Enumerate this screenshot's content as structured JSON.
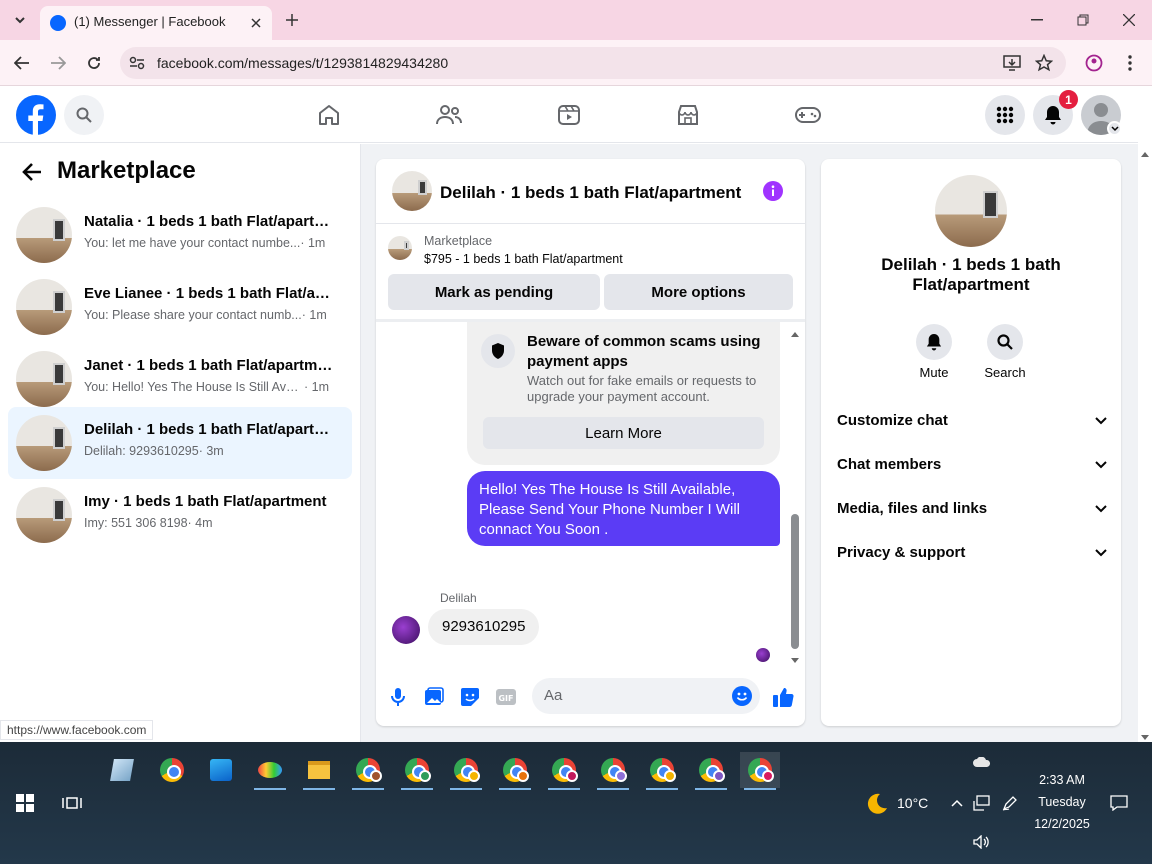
{
  "browser": {
    "tab_title": "(1) Messenger | Facebook",
    "url": "facebook.com/messages/t/1293814829434280",
    "status_url": "https://www.facebook.com"
  },
  "header": {
    "notification_count": "1"
  },
  "left": {
    "title": "Marketplace",
    "conversations": [
      {
        "title": "Natalia · 1 beds 1 bath Flat/apartm...",
        "preview": "You: let me have your contact numbe...",
        "time": "· 1m",
        "selected": false
      },
      {
        "title": "Eve Lianee · 1 beds 1 bath Flat/apa...",
        "preview": "You: Please share your contact numb...",
        "time": "· 1m",
        "selected": false
      },
      {
        "title": "Janet · 1 beds 1 bath Flat/apartment",
        "preview": "You: Hello! Yes The House Is Still Avail...",
        "time": "· 1m",
        "selected": false
      },
      {
        "title": "Delilah · 1 beds 1 bath Flat/apartm...",
        "preview": "Delilah: 9293610295",
        "time": "· 3m",
        "selected": true
      },
      {
        "title": "Imy · 1 beds 1 bath Flat/apartment",
        "preview": "Imy: 551 306 8198",
        "time": "· 4m",
        "selected": false
      }
    ]
  },
  "chat": {
    "title": "Delilah · 1 beds 1 bath Flat/apartment",
    "listing_source": "Marketplace",
    "listing_desc": "$795 - 1 beds 1 bath Flat/apartment",
    "mark_pending": "Mark as pending",
    "more_options": "More options",
    "scam_title": "Beware of common scams using payment apps",
    "scam_body": "Watch out for fake emails or requests to upgrade your payment account.",
    "learn_more": "Learn More",
    "sent_message": "Hello! Yes The House  Is Still Available, Please Send Your Phone Number I Will connact You Soon .",
    "sender_name": "Delilah",
    "received_message": "9293610295",
    "input_placeholder": "Aa"
  },
  "right": {
    "name": "Delilah · 1 beds 1 bath Flat/apartment",
    "mute": "Mute",
    "search": "Search",
    "sections": [
      "Customize chat",
      "Chat members",
      "Media, files and links",
      "Privacy & support"
    ]
  },
  "taskbar": {
    "weather": "10°C",
    "time": "2:33 AM",
    "day": "Tuesday",
    "date": "12/2/2025"
  },
  "colors": {
    "fb_blue": "#0866ff",
    "messenger_purple": "#5b3cf5",
    "notif_red": "#e41e3f",
    "selected_bg": "#ebf5ff"
  }
}
